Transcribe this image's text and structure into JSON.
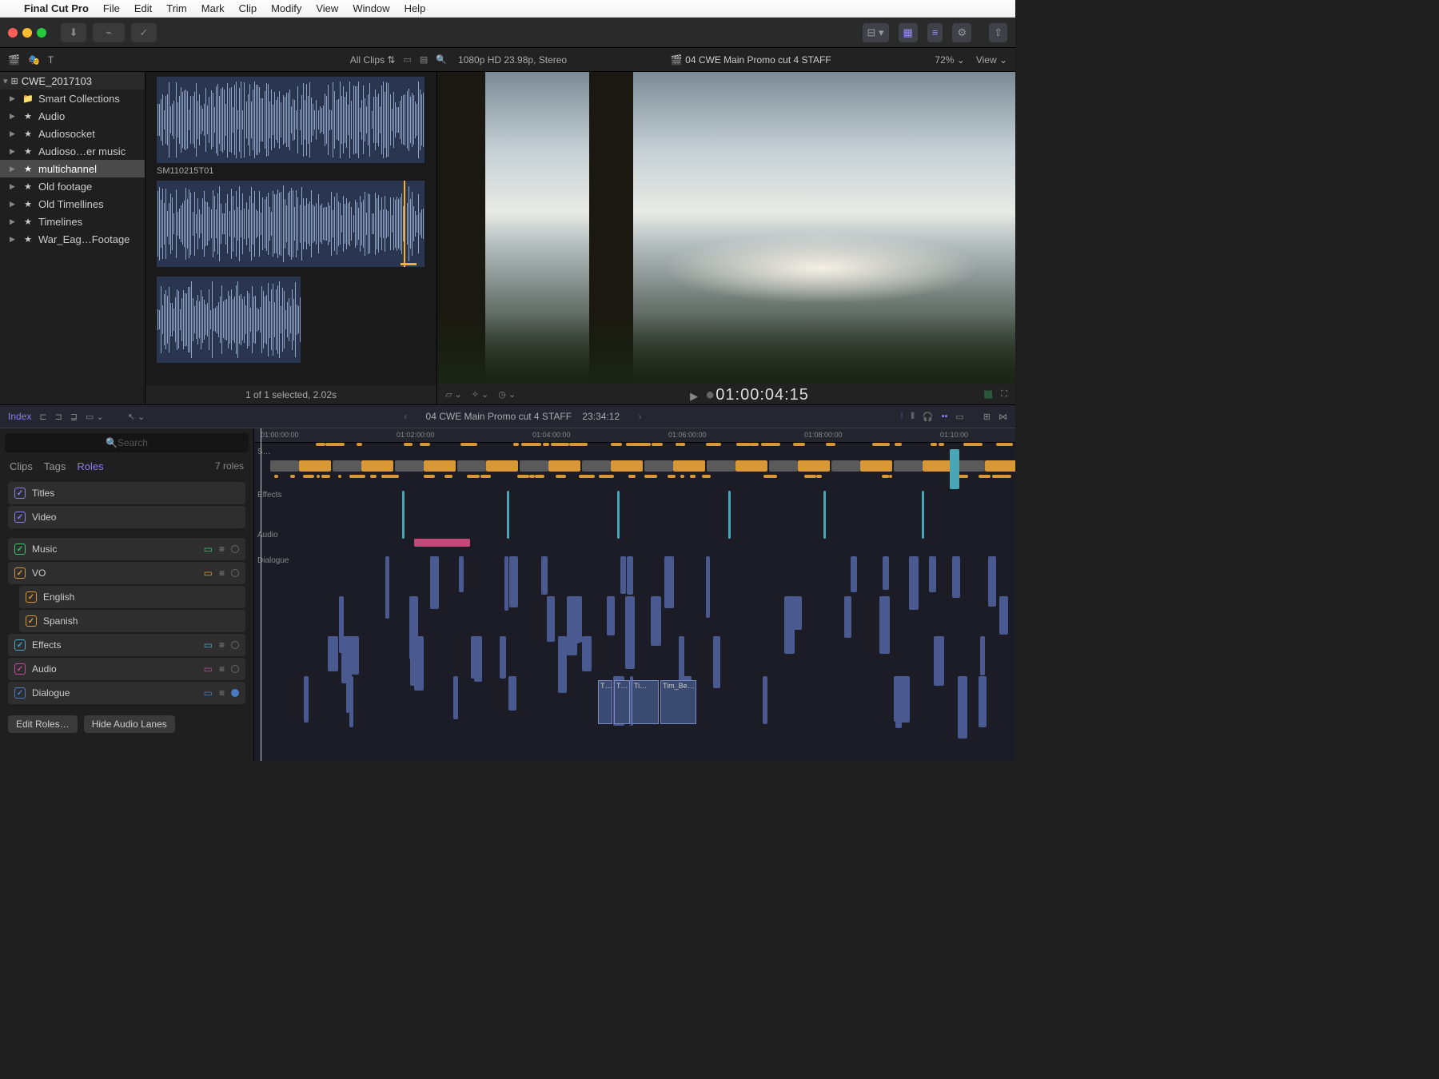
{
  "menubar": {
    "app": "Final Cut Pro",
    "items": [
      "File",
      "Edit",
      "Trim",
      "Mark",
      "Clip",
      "Modify",
      "View",
      "Window",
      "Help"
    ]
  },
  "sec_toolbar": {
    "filter": "All Clips",
    "format": "1080p HD 23.98p, Stereo",
    "project": "04 CWE Main Promo cut 4 STAFF",
    "zoom": "72%",
    "view": "View"
  },
  "library": {
    "name": "CWE_2017103",
    "items": [
      {
        "icon": "folder",
        "label": "Smart Collections"
      },
      {
        "icon": "star",
        "label": "Audio"
      },
      {
        "icon": "star",
        "label": "Audiosocket"
      },
      {
        "icon": "star",
        "label": "Audioso…er music"
      },
      {
        "icon": "star",
        "label": "multichannel",
        "selected": true
      },
      {
        "icon": "star",
        "label": "Old footage"
      },
      {
        "icon": "star",
        "label": "Old Timellines"
      },
      {
        "icon": "star",
        "label": "Timelines"
      },
      {
        "icon": "star",
        "label": "War_Eag…Footage"
      }
    ]
  },
  "browser": {
    "clip_name": "SM110215T01",
    "status": "1 of 1 selected, 2.02s"
  },
  "viewer": {
    "timecode": "01:00:04:15"
  },
  "timeline_header": {
    "index": "Index",
    "title": "04 CWE Main Promo cut 4 STAFF",
    "duration": "23:34:12"
  },
  "index": {
    "search_placeholder": "Search",
    "tabs": [
      "Clips",
      "Tags",
      "Roles"
    ],
    "active_tab": "Roles",
    "count": "7 roles",
    "roles": [
      {
        "label": "Titles",
        "color": "#8a7cf5"
      },
      {
        "label": "Video",
        "color": "#8a7cf5"
      },
      {
        "label": "Music",
        "color": "#3ac56a",
        "actions": true
      },
      {
        "label": "VO",
        "color": "#d89838",
        "actions": true
      },
      {
        "label": "English",
        "color": "#d89838",
        "sub": true
      },
      {
        "label": "Spanish",
        "color": "#d89838",
        "sub": true
      },
      {
        "label": "Effects",
        "color": "#4aa5c5",
        "actions": true
      },
      {
        "label": "Audio",
        "color": "#c54a9a",
        "actions": true
      },
      {
        "label": "Dialogue",
        "color": "#4a7ac5",
        "actions": true,
        "active_circle": true
      }
    ],
    "buttons": {
      "edit": "Edit Roles…",
      "hide": "Hide Audio Lanes"
    }
  },
  "ruler": {
    "marks": [
      "01:00:00:00",
      "01:02:00:00",
      "01:04:00:00",
      "01:06:00:00",
      "01:08:00:00",
      "01:10:00"
    ]
  },
  "lanes": [
    "S…",
    "Effects",
    "Audio",
    "Dialogue"
  ],
  "sel_clips": [
    "T…",
    "T…",
    "Ti…",
    "Tim_Be…"
  ]
}
